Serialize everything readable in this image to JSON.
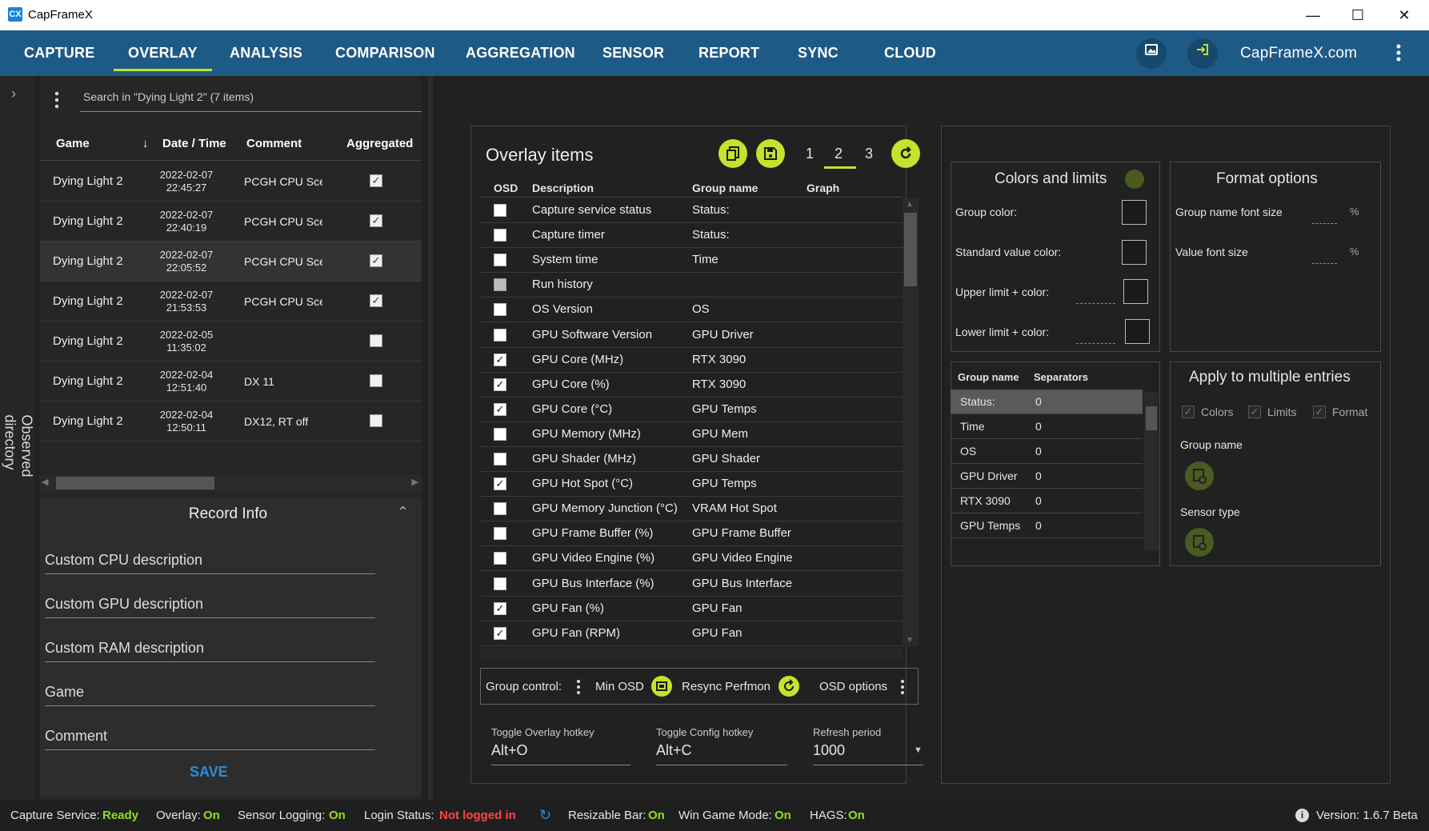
{
  "window": {
    "title": "CapFrameX",
    "min": "—",
    "max": "☐",
    "close": "✕"
  },
  "nav": {
    "tabs": [
      "CAPTURE",
      "OVERLAY",
      "ANALYSIS",
      "COMPARISON",
      "AGGREGATION",
      "SENSOR",
      "REPORT",
      "SYNC",
      "CLOUD"
    ],
    "active": "OVERLAY",
    "site": "CapFrameX.com",
    "accent": "#c4e32c"
  },
  "sidebar": {
    "label": "Observed directory",
    "search_placeholder": "Search in \"Dying Light 2\" (7 items)",
    "columns": {
      "game": "Game",
      "datetime": "Date / Time",
      "comment": "Comment",
      "aggregated": "Aggregated"
    },
    "records": [
      {
        "game": "Dying Light 2",
        "date": "2022-02-07",
        "time": "22:45:27",
        "comment": "PCGH CPU Scen",
        "aggregated": true
      },
      {
        "game": "Dying Light 2",
        "date": "2022-02-07",
        "time": "22:40:19",
        "comment": "PCGH CPU Scen",
        "aggregated": true
      },
      {
        "game": "Dying Light 2",
        "date": "2022-02-07",
        "time": "22:05:52",
        "comment": "PCGH CPU Scen",
        "aggregated": true
      },
      {
        "game": "Dying Light 2",
        "date": "2022-02-07",
        "time": "21:53:53",
        "comment": "PCGH CPU Scen",
        "aggregated": true
      },
      {
        "game": "Dying Light 2",
        "date": "2022-02-05",
        "time": "11:35:02",
        "comment": "",
        "aggregated": false
      },
      {
        "game": "Dying Light 2",
        "date": "2022-02-04",
        "time": "12:51:40",
        "comment": "DX 11",
        "aggregated": false
      },
      {
        "game": "Dying Light 2",
        "date": "2022-02-04",
        "time": "12:50:11",
        "comment": "DX12, RT off",
        "aggregated": false
      }
    ],
    "record_info": {
      "title": "Record Info",
      "fields": [
        "Custom CPU description",
        "Custom GPU description",
        "Custom RAM description",
        "Game",
        "Comment"
      ],
      "save": "SAVE"
    }
  },
  "overlay": {
    "title": "Overlay items",
    "pages": [
      "1",
      "2",
      "3"
    ],
    "active_page": "2",
    "columns": {
      "osd": "OSD",
      "description": "Description",
      "group": "Group name",
      "graph": "Graph"
    },
    "items": [
      {
        "osd": false,
        "desc": "Capture service status",
        "group": "Status:"
      },
      {
        "osd": false,
        "desc": "Capture timer",
        "group": "Status:"
      },
      {
        "osd": false,
        "desc": "System time",
        "group": "Time"
      },
      {
        "osd": false,
        "desc": "Run history",
        "group": "",
        "disabled": true
      },
      {
        "osd": false,
        "desc": "OS Version",
        "group": "OS"
      },
      {
        "osd": false,
        "desc": "GPU Software Version",
        "group": "GPU Driver"
      },
      {
        "osd": true,
        "desc": "GPU Core (MHz)",
        "group": "RTX 3090"
      },
      {
        "osd": true,
        "desc": "GPU Core (%)",
        "group": "RTX 3090"
      },
      {
        "osd": true,
        "desc": "GPU Core (°C)",
        "group": "GPU Temps"
      },
      {
        "osd": false,
        "desc": "GPU Memory (MHz)",
        "group": "GPU Mem"
      },
      {
        "osd": false,
        "desc": "GPU Shader (MHz)",
        "group": "GPU Shader"
      },
      {
        "osd": true,
        "desc": "GPU Hot Spot (°C)",
        "group": "GPU Temps"
      },
      {
        "osd": false,
        "desc": "GPU Memory Junction (°C)",
        "group": "VRAM Hot Spot"
      },
      {
        "osd": false,
        "desc": "GPU Frame Buffer (%)",
        "group": "GPU Frame Buffer"
      },
      {
        "osd": false,
        "desc": "GPU Video Engine (%)",
        "group": "GPU Video Engine"
      },
      {
        "osd": false,
        "desc": "GPU Bus Interface (%)",
        "group": "GPU Bus Interface"
      },
      {
        "osd": true,
        "desc": "GPU Fan (%)",
        "group": "GPU Fan"
      },
      {
        "osd": true,
        "desc": "GPU Fan (RPM)",
        "group": "GPU Fan"
      }
    ],
    "group_control": {
      "label": "Group control:",
      "min_osd": "Min OSD",
      "resync": "Resync Perfmon",
      "osd_options": "OSD options"
    },
    "hotkeys": {
      "toggle_overlay_label": "Toggle Overlay hotkey",
      "toggle_overlay_value": "Alt+O",
      "toggle_config_label": "Toggle Config hotkey",
      "toggle_config_value": "Alt+C",
      "refresh_label": "Refresh period",
      "refresh_value": "1000"
    }
  },
  "colors_limits": {
    "title": "Colors and limits",
    "group_color": "Group color:",
    "standard_color": "Standard value color:",
    "upper": "Upper limit + color:",
    "lower": "Lower limit + color:"
  },
  "format_options": {
    "title": "Format options",
    "group_font": "Group name font size",
    "value_font": "Value font size",
    "unit": "%"
  },
  "separators": {
    "col_group": "Group name",
    "col_sep": "Separators",
    "rows": [
      {
        "name": "Status:",
        "sep": "0"
      },
      {
        "name": "Time",
        "sep": "0"
      },
      {
        "name": "OS",
        "sep": "0"
      },
      {
        "name": "GPU Driver",
        "sep": "0"
      },
      {
        "name": "RTX 3090",
        "sep": "0"
      },
      {
        "name": "GPU Temps",
        "sep": "0"
      }
    ]
  },
  "apply_multiple": {
    "title": "Apply to multiple entries",
    "colors": "Colors",
    "limits": "Limits",
    "format": "Format",
    "group_name": "Group name",
    "sensor_type": "Sensor type"
  },
  "status": {
    "capture_label": "Capture Service:",
    "capture_value": "Ready",
    "overlay_label": "Overlay:",
    "overlay_value": "On",
    "sensor_label": "Sensor Logging:",
    "sensor_value": "On",
    "login_label": "Login Status:",
    "login_value": "Not logged in",
    "rebar_label": "Resizable Bar:",
    "rebar_value": "On",
    "gamemode_label": "Win Game Mode:",
    "gamemode_value": "On",
    "hags_label": "HAGS:",
    "hags_value": "On",
    "version": "Version:  1.6.7 Beta"
  }
}
